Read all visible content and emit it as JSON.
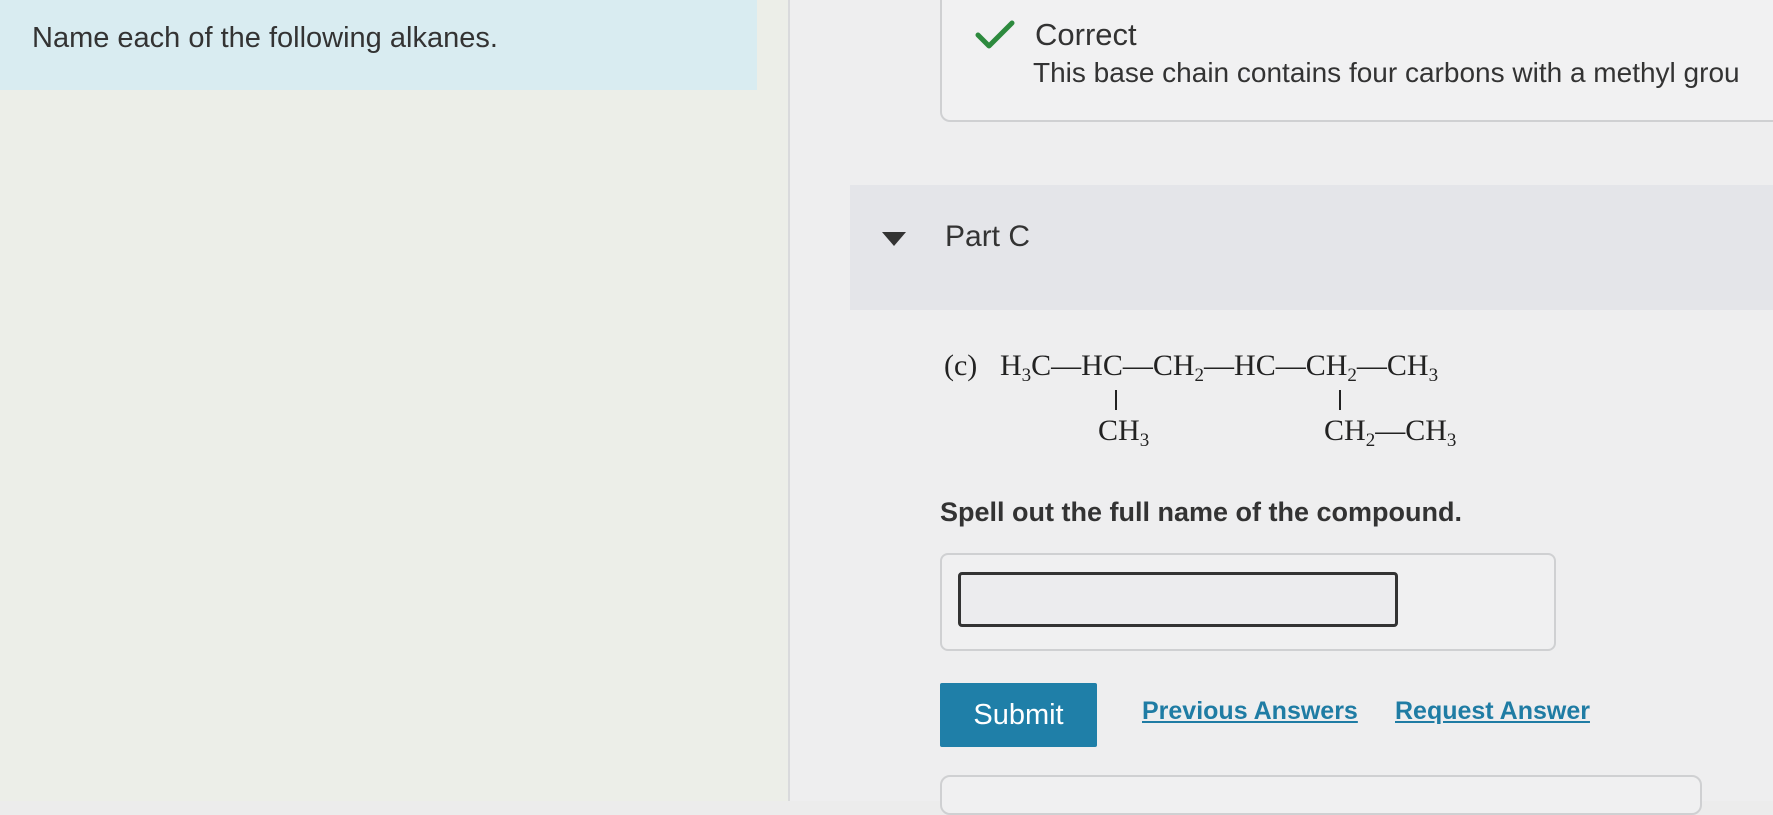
{
  "intro": {
    "text": "Name each of the following alkanes."
  },
  "feedback": {
    "title": "Correct",
    "message": "This base chain contains four carbons with a methyl grou",
    "icon": "check-icon",
    "icon_color": "#2d8a3e"
  },
  "part": {
    "title": "Part C",
    "icon": "caret-down-icon"
  },
  "formula": {
    "label": "(c)",
    "main_chain": [
      "H",
      "3",
      "C—HC—CH",
      "2",
      "—HC—CH",
      "2",
      "—CH",
      "3"
    ],
    "sub1": [
      "CH",
      "3"
    ],
    "sub2": [
      "CH",
      "2",
      "—CH",
      "3"
    ]
  },
  "question": {
    "instruction": "Spell out the full name of the compound."
  },
  "answer": {
    "value": "",
    "placeholder": ""
  },
  "actions": {
    "submit_label": "Submit",
    "previous_answers_label": "Previous Answers",
    "request_answer_label": "Request Answer"
  },
  "colors": {
    "submit_bg": "#1f7fa8",
    "link": "#1f7ca4",
    "intro_bg": "#d9ecf1"
  }
}
